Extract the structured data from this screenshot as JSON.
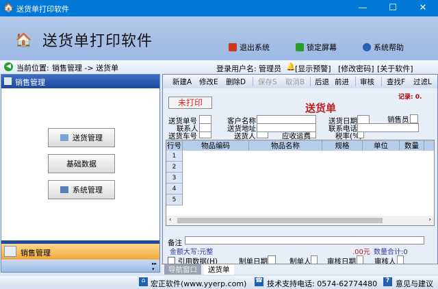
{
  "window": {
    "title": "送货单打印软件",
    "minimize": "—",
    "maximize": "☐",
    "close": "✕"
  },
  "header": {
    "app_title": "送货单打印软件",
    "buttons": [
      {
        "label": "退出系统",
        "color": "#d03a1c"
      },
      {
        "label": "锁定屏幕",
        "color": "#2d9b2d"
      },
      {
        "label": "系统帮助",
        "color": "#2a5fb8"
      }
    ]
  },
  "breadcrumb": {
    "label": "当前位置:",
    "path": "销售管理 -> 送货单",
    "user_label": "登录用户名:",
    "user": "管理员",
    "links": [
      "[显示预警]",
      "[修改密码]",
      "[关于软件]"
    ]
  },
  "sidebar": {
    "title": "销售管理",
    "buttons": [
      "送货管理",
      "基础数据",
      "系统管理"
    ],
    "bottom_section": "销售管理"
  },
  "toolbar": {
    "items": [
      {
        "label": "新建A",
        "enabled": true
      },
      {
        "label": "修改E",
        "enabled": true
      },
      {
        "label": "删除D",
        "enabled": true
      },
      {
        "label": "保存S",
        "enabled": false
      },
      {
        "label": "取消B",
        "enabled": false
      },
      {
        "label": "后退",
        "enabled": true
      },
      {
        "label": "前进",
        "enabled": true
      },
      {
        "label": "审核",
        "enabled": true
      },
      {
        "label": "查找F",
        "enabled": true
      },
      {
        "label": "过滤L",
        "enabled": true
      }
    ]
  },
  "form": {
    "status": "未打印",
    "record": "记录: 0.",
    "title": "送货单",
    "labels": {
      "order_no": "送货单号",
      "contact": "联系人",
      "car_no": "送货车号",
      "customer": "客户名称",
      "address": "送货地址",
      "deliverer": "送货人",
      "freight": "应收运费",
      "date": "送货日期",
      "phone": "联系电话",
      "tax": "税率(%)",
      "salesman": "销售员"
    },
    "grid": {
      "headers": [
        "行号",
        "物品编码",
        "物品名称",
        "规格",
        "单位",
        "数量"
      ],
      "rows": [
        "1",
        "2",
        "3",
        "4",
        "5"
      ]
    },
    "remark": "备注",
    "amount_upper": "金额大写:元整",
    "amount": ".00元",
    "qty_total": "数量合计:0",
    "ref_data": "引用数据(H)",
    "made_date": "制单日期",
    "maker": "制单人",
    "audit_date": "审核日期",
    "auditor": "审核人"
  },
  "tabs": [
    "导航窗口",
    "送货单"
  ],
  "status": {
    "company": "宏正软件(www.yyerp.com)",
    "support": "技术支持电话: 0574-62774480",
    "feedback": "意见与建议"
  }
}
